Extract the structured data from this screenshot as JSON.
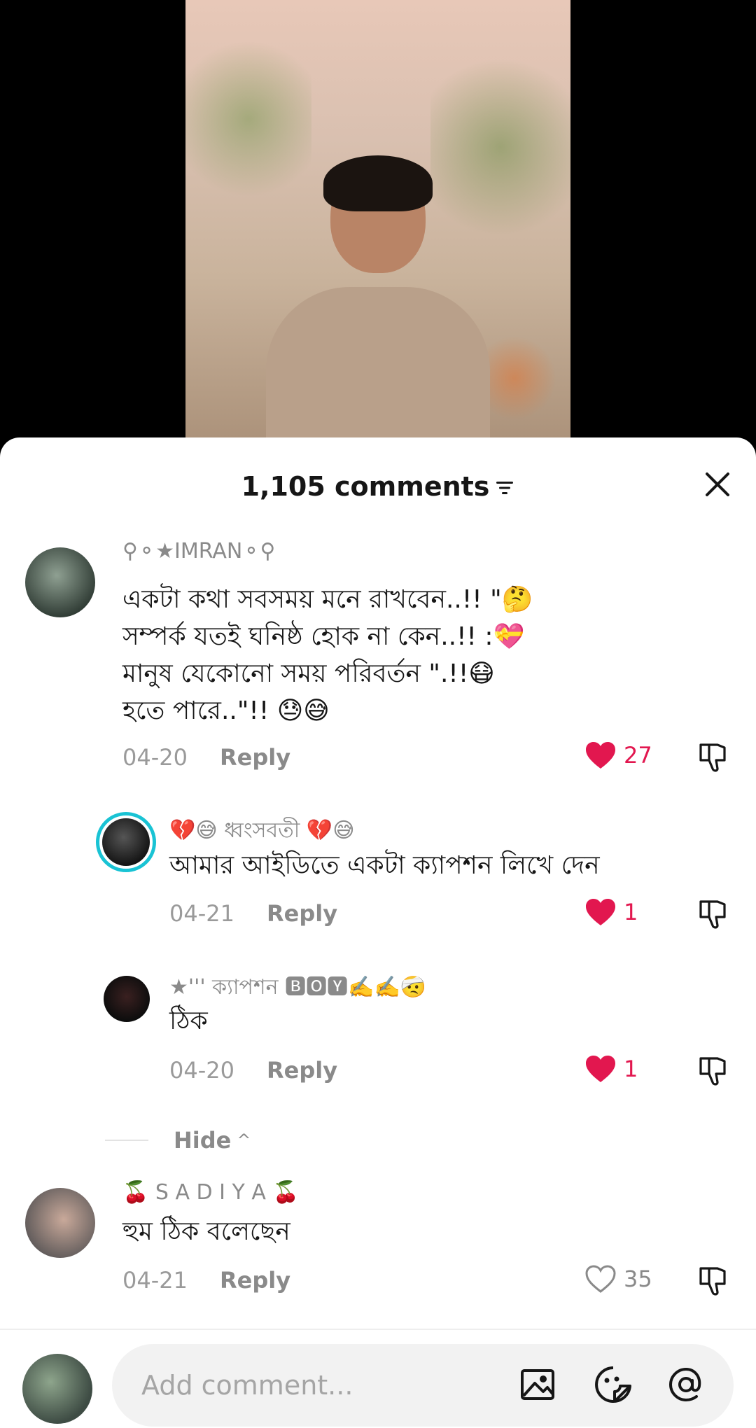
{
  "header": {
    "comment_count": "1,105 comments"
  },
  "comments": [
    {
      "username": "⚲⚬★IMRAN⚬⚲",
      "lines": [
        "একটা কথা সবসময় মনে রাখবেন..!! \"🤔",
        "সম্পর্ক যতই ঘনিষ্ঠ হোক না কেন..!! :💝",
        "মানুষ যেকোনো সময় পরিবর্তন \".!!😷",
        "হতে পারে..\"!! 😓😅"
      ],
      "date": "04-20",
      "reply_label": "Reply",
      "likes": "27",
      "liked": true
    },
    {
      "username": "💔😅 ধ্বংসবতী 💔😅",
      "lines": [
        "আমার আইডিতে একটা ক্যাপশন লিখে দেন"
      ],
      "date": "04-21",
      "reply_label": "Reply",
      "likes": "1",
      "liked": true
    },
    {
      "username": "★''' ক্যাপশন 🅱🅾🆈✍️✍️🤕",
      "lines": [
        "ঠিক"
      ],
      "date": "04-20",
      "reply_label": "Reply",
      "likes": "1",
      "liked": true
    },
    {
      "username": "🍒 S A D I Y A 🍒",
      "lines": [
        "হুম ঠিক বলেছেন"
      ],
      "date": "04-21",
      "reply_label": "Reply",
      "likes": "35",
      "liked": false
    }
  ],
  "hide_label": "Hide",
  "input": {
    "placeholder": "Add comment..."
  },
  "colors": {
    "like_red": "#e2174f",
    "text_grey": "#8a8a8a",
    "story_ring": "#19c3d4"
  }
}
